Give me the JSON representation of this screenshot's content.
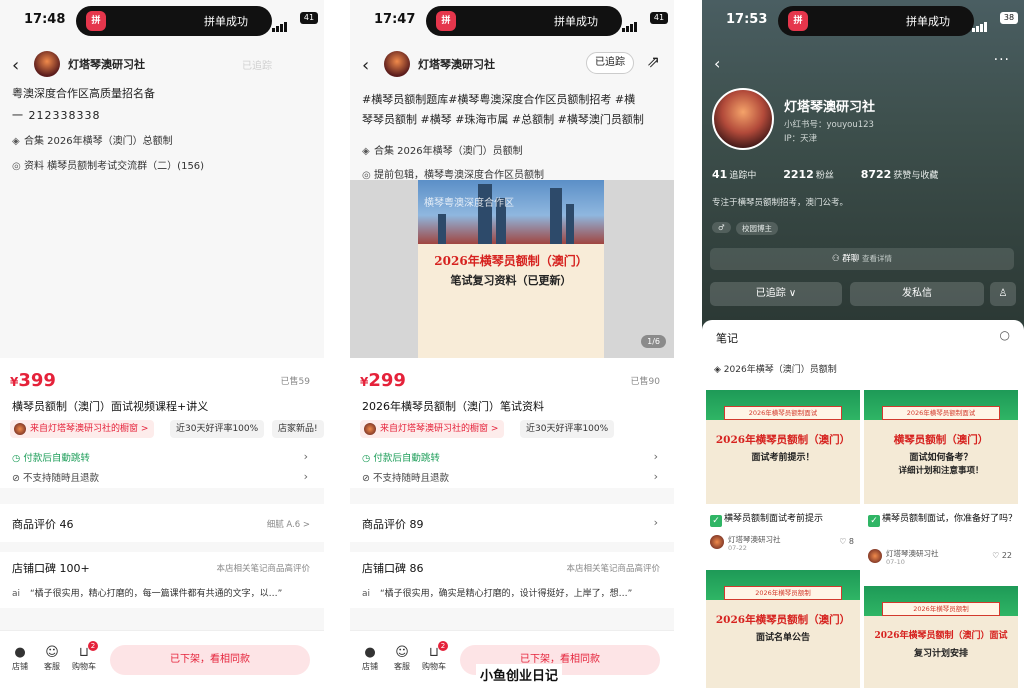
{
  "panel1": {
    "time": "17:48",
    "island_text": "拼单成功",
    "battery": "41",
    "shop_name": "灯塔琴澳研习社",
    "follow_faint": "已追踪",
    "text_line1": "粤澳深度合作区高质量招名备",
    "text_line2": "一  212338338",
    "collection": "合集  2026年横琴（澳门）总额制",
    "material": "资料  横琴员额制考试交流群（二）(156)",
    "price": "399",
    "sold": "已售59",
    "title": "横琴员额制（澳门）面试视频课程+讲义",
    "tag_from": "来自灯塔琴澳研习社的橱窗 >",
    "tag_rate": "近30天好评率100%",
    "tag_new": "店家新品!",
    "auto": "付款后自動跳转",
    "refund": "不支持随時且退款",
    "reviews_title": "商品评价 46",
    "reviews_right": "细腻 A.6 >",
    "shop_rep": "店铺口碑 100+",
    "shop_rep_right": "本店相关笔记商品高评价",
    "quote_prefix": "ai",
    "quote": "“橘子很实用，精心打磨的，每一篇课件都有共通的文字，以…”",
    "bottom_shop": "店铺",
    "bottom_service": "客服",
    "bottom_cart": "购物车",
    "cart_count": "2",
    "off_shelf": "已下架，看相同款"
  },
  "panel2": {
    "time": "17:47",
    "island_text": "拼单成功",
    "battery": "41",
    "shop_name": "灯塔琴澳研习社",
    "follow_btn": "已追踪",
    "text_line1": "#横琴员额制题库#横琴粤澳深度合作区员额制招考 #横",
    "text_line2": "琴琴员额制 #横琴 #珠海市属 #总额制 #横琴澳门员额制",
    "collection": "合集  2026年横琴（澳门）员额制",
    "material": "提前包辑，横琴粤澳深度合作区员额制",
    "promo_overlay": "横琴粤澳深度合作区",
    "promo_h1": "2026年横琴员额制（澳门）",
    "promo_h2": "笔试复习资料（已更新）",
    "pager": "1/6",
    "price": "299",
    "sold": "已售90",
    "title": "2026年横琴员额制（澳门）笔试资料",
    "tag_from": "来自灯塔琴澳研习社的橱窗 >",
    "tag_rate": "近30天好评率100%",
    "auto": "付款后自動跳转",
    "refund": "不支持随時且退款",
    "reviews_title": "商品评价 89",
    "shop_rep": "店铺口碑 86",
    "shop_rep_right": "本店相关笔记商品高评价",
    "quote_prefix": "ai",
    "quote": "“橘子很实用，确实是精心打磨的，设计得挺好，上岸了，想…”",
    "bottom_shop": "店铺",
    "bottom_service": "客服",
    "bottom_cart": "购物车",
    "cart_count": "2",
    "off_shelf": "已下架，看相同款"
  },
  "panel3": {
    "time": "17:53",
    "island_text": "拼单成功",
    "battery": "38",
    "name": "灯塔琴澳研习社",
    "id": "小红书号：youyou123",
    "ip": "IP：天津",
    "following": "41",
    "following_label": "追踪中",
    "fans": "2212",
    "fans_label": "粉丝",
    "likes": "8722",
    "likes_label": "获赞与收藏",
    "bio": "专注于横琴员额制招考，澳门公考。",
    "tag1": "♂",
    "tag2": "校园博主",
    "group": "群聊",
    "group_sub": "查看详情",
    "btn_follow": "已追踪 ∨",
    "btn_msg": "发私信",
    "notes_title": "笔记",
    "collection": "2026年横琴（澳门）员额制",
    "cards": [
      {
        "band": "2026年横琴员额制面试",
        "t1": "2026年横琴员额制（澳门）",
        "t2": "面试考前提示！",
        "t3": "",
        "caption": "横琴员额制面试考前提示",
        "author": "灯塔琴澳研习社",
        "date": "07-22",
        "likes": "8"
      },
      {
        "band": "2026年横琴员额制面试",
        "t1": "横琴员额制（澳门）",
        "t2": "面试如何备考？",
        "t3": "详细计划和注意事项！",
        "caption": "横琴员额制面试，你准备好了吗？",
        "author": "灯塔琴澳研习社",
        "date": "07-10",
        "likes": "22"
      },
      {
        "band": "2026年横琴员额制",
        "t1": "2026年横琴员额制（澳门）",
        "t2": "面试名单公告",
        "t3": "",
        "caption": "",
        "author": "",
        "date": "",
        "likes": ""
      },
      {
        "band": "2026年横琴员额制",
        "t1": "2026年横琴员额制（澳门）面试",
        "t2": "复习计划安排",
        "t3": "",
        "caption": "",
        "author": "",
        "date": "",
        "likes": ""
      }
    ]
  },
  "watermark": "小鱼创业日记",
  "colors": {
    "accent": "#e5223a",
    "green": "#1e9e5a"
  }
}
